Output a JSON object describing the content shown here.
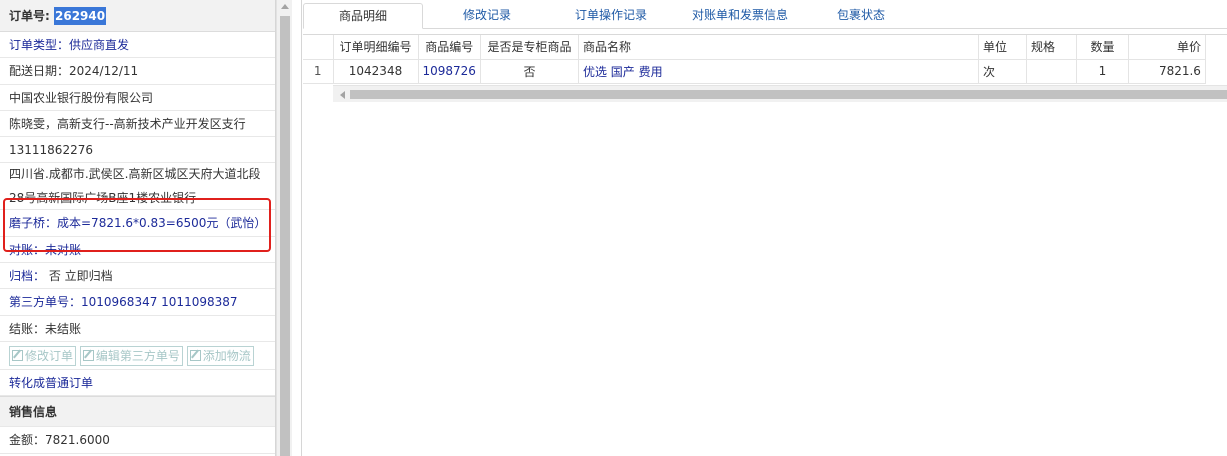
{
  "order": {
    "number_label": "订单号:",
    "number_value": "262940",
    "type": "订单类型：供应商直发",
    "delivery_date": "配送日期：2024/12/11",
    "customer": "中国农业银行股份有限公司",
    "contact": "陈晓雯，高新支行--高新技术产业开发区支行",
    "phone": "13111862276",
    "address_line1": "四川省.成都市.武侯区.高新区城区天府大道北段",
    "address_line2": "28号高新国际广场B座1楼农业银行",
    "note": "磨子桥：成本=7821.6*0.83=6500元（武怡）",
    "reconcile": "对账：未对账",
    "archive_label": "归档：",
    "archive_value": "否 立即归档",
    "third_party": "第三方单号：1010968347 1011098387",
    "settle": "结账：未结账",
    "buttons": {
      "edit_order": "修改订单",
      "edit_third_party": "编辑第三方单号",
      "add_logistics": "添加物流"
    },
    "convert": "转化成普通订单"
  },
  "sales": {
    "section_title": "销售信息",
    "amount": "金额：7821.6000"
  },
  "tabs": [
    {
      "label": "商品明细"
    },
    {
      "label": "修改记录"
    },
    {
      "label": "订单操作记录"
    },
    {
      "label": "对账单和发票信息"
    },
    {
      "label": "包裹状态"
    }
  ],
  "grid": {
    "headers": [
      "",
      "订单明细编号",
      "商品编号",
      "是否是专柜商品",
      "商品名称",
      "单位",
      "规格",
      "数量",
      "单价"
    ],
    "rows": [
      [
        "1",
        "1042348",
        "1098726",
        "否",
        "优选 国产 费用",
        "次",
        "",
        "1",
        "7821.6"
      ]
    ]
  },
  "colors": {
    "accent": "#1f5aa6",
    "link": "#1c2a99",
    "highlight": "#3a77d8",
    "annotation": "#e0201c"
  }
}
